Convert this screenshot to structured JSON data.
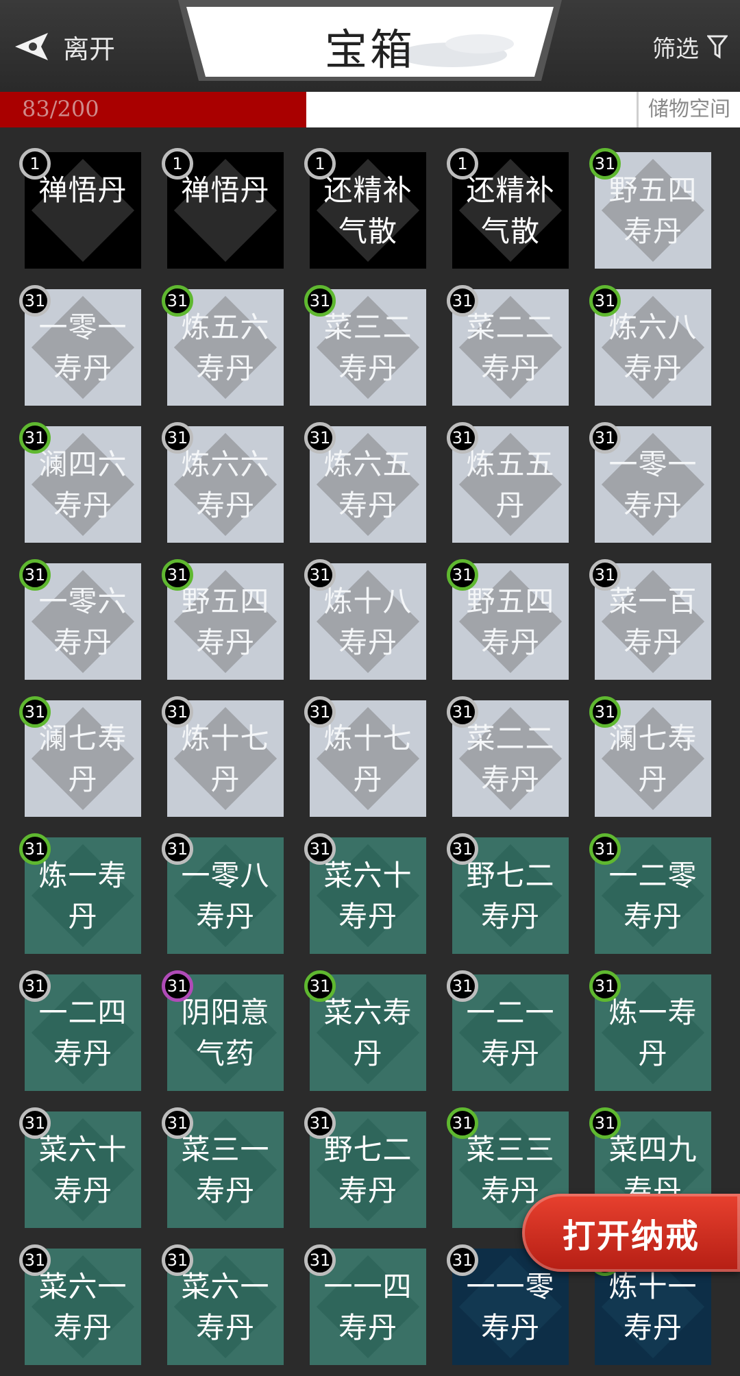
{
  "header": {
    "back_label": "离开",
    "title": "宝箱",
    "filter_label": "筛选"
  },
  "capacity": {
    "text": "83/200",
    "used": 83,
    "total": 200,
    "label": "储物空间"
  },
  "open_button": "打开纳戒",
  "items": [
    {
      "name": "禅悟丹",
      "count": "1",
      "style": "black",
      "badge": "grey"
    },
    {
      "name": "禅悟丹",
      "count": "1",
      "style": "black",
      "badge": "grey"
    },
    {
      "name": "还精补气散",
      "count": "1",
      "style": "black",
      "badge": "grey"
    },
    {
      "name": "还精补气散",
      "count": "1",
      "style": "black",
      "badge": "grey"
    },
    {
      "name": "野五四寿丹",
      "count": "31",
      "style": "grey",
      "badge": "green"
    },
    {
      "name": "一零一寿丹",
      "count": "31",
      "style": "grey",
      "badge": "grey"
    },
    {
      "name": "炼五六寿丹",
      "count": "31",
      "style": "grey",
      "badge": "green"
    },
    {
      "name": "菜三二寿丹",
      "count": "31",
      "style": "grey",
      "badge": "green"
    },
    {
      "name": "菜二二寿丹",
      "count": "31",
      "style": "grey",
      "badge": "grey"
    },
    {
      "name": "炼六八寿丹",
      "count": "31",
      "style": "grey",
      "badge": "green"
    },
    {
      "name": "澜四六寿丹",
      "count": "31",
      "style": "grey",
      "badge": "green"
    },
    {
      "name": "炼六六寿丹",
      "count": "31",
      "style": "grey",
      "badge": "grey"
    },
    {
      "name": "炼六五寿丹",
      "count": "31",
      "style": "grey",
      "badge": "grey"
    },
    {
      "name": "炼五五丹",
      "count": "31",
      "style": "grey",
      "badge": "grey"
    },
    {
      "name": "一零一寿丹",
      "count": "31",
      "style": "grey",
      "badge": "grey"
    },
    {
      "name": "一零六寿丹",
      "count": "31",
      "style": "grey",
      "badge": "green"
    },
    {
      "name": "野五四寿丹",
      "count": "31",
      "style": "grey",
      "badge": "green"
    },
    {
      "name": "炼十八寿丹",
      "count": "31",
      "style": "grey",
      "badge": "grey"
    },
    {
      "name": "野五四寿丹",
      "count": "31",
      "style": "grey",
      "badge": "green"
    },
    {
      "name": "菜一百寿丹",
      "count": "31",
      "style": "grey",
      "badge": "grey"
    },
    {
      "name": "澜七寿丹",
      "count": "31",
      "style": "grey",
      "badge": "green"
    },
    {
      "name": "炼十七丹",
      "count": "31",
      "style": "grey",
      "badge": "grey"
    },
    {
      "name": "炼十七丹",
      "count": "31",
      "style": "grey",
      "badge": "grey"
    },
    {
      "name": "菜二二寿丹",
      "count": "31",
      "style": "grey",
      "badge": "grey"
    },
    {
      "name": "澜七寿丹",
      "count": "31",
      "style": "grey",
      "badge": "green"
    },
    {
      "name": "炼一寿丹",
      "count": "31",
      "style": "teal",
      "badge": "green"
    },
    {
      "name": "一零八寿丹",
      "count": "31",
      "style": "teal",
      "badge": "grey"
    },
    {
      "name": "菜六十寿丹",
      "count": "31",
      "style": "teal",
      "badge": "grey"
    },
    {
      "name": "野七二寿丹",
      "count": "31",
      "style": "teal",
      "badge": "grey"
    },
    {
      "name": "一二零寿丹",
      "count": "31",
      "style": "teal",
      "badge": "green"
    },
    {
      "name": "一二四寿丹",
      "count": "31",
      "style": "teal",
      "badge": "grey"
    },
    {
      "name": "阴阳意气药",
      "count": "31",
      "style": "teal",
      "badge": "purple"
    },
    {
      "name": "菜六寿丹",
      "count": "31",
      "style": "teal",
      "badge": "green"
    },
    {
      "name": "一二一寿丹",
      "count": "31",
      "style": "teal",
      "badge": "grey"
    },
    {
      "name": "炼一寿丹",
      "count": "31",
      "style": "teal",
      "badge": "green"
    },
    {
      "name": "菜六十寿丹",
      "count": "31",
      "style": "teal",
      "badge": "grey"
    },
    {
      "name": "菜三一寿丹",
      "count": "31",
      "style": "teal",
      "badge": "grey"
    },
    {
      "name": "野七二寿丹",
      "count": "31",
      "style": "teal",
      "badge": "grey"
    },
    {
      "name": "菜三三寿丹",
      "count": "31",
      "style": "teal",
      "badge": "green"
    },
    {
      "name": "菜四九寿丹",
      "count": "31",
      "style": "teal",
      "badge": "green"
    },
    {
      "name": "菜六一寿丹",
      "count": "31",
      "style": "teal",
      "badge": "grey"
    },
    {
      "name": "菜六一寿丹",
      "count": "31",
      "style": "teal",
      "badge": "grey"
    },
    {
      "name": "一一四寿丹",
      "count": "31",
      "style": "teal",
      "badge": "grey"
    },
    {
      "name": "一一零寿丹",
      "count": "31",
      "style": "navy",
      "badge": "grey"
    },
    {
      "name": "炼十一寿丹",
      "count": "",
      "style": "navy",
      "badge": "green"
    }
  ]
}
